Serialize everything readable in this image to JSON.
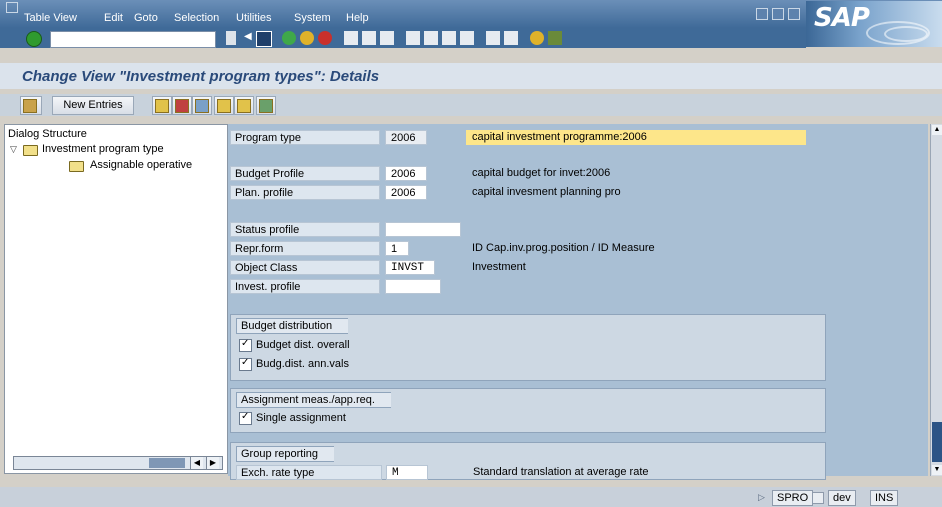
{
  "menu": {
    "items": [
      {
        "label": "Table View"
      },
      {
        "label": "Edit"
      },
      {
        "label": "Goto"
      },
      {
        "label": "Selection"
      },
      {
        "label": "Utilities"
      },
      {
        "label": "System"
      },
      {
        "label": "Help"
      }
    ]
  },
  "brand": {
    "logo_text": "SAP"
  },
  "toolbar": {
    "command_field_value": ""
  },
  "title": {
    "text": "Change View \"Investment program types\": Details"
  },
  "app_toolbar": {
    "new_entries_label": "New Entries"
  },
  "tree": {
    "header": "Dialog Structure",
    "items": [
      {
        "label": "Investment program type"
      },
      {
        "label": "Assignable operative"
      }
    ]
  },
  "form": {
    "program_type": {
      "label": "Program type",
      "value": "2006",
      "desc": "capital investment programme:2006"
    },
    "budget_profile": {
      "label": "Budget Profile",
      "value": "2006",
      "desc": "capital budget for invet:2006"
    },
    "plan_profile": {
      "label": "Plan. profile",
      "value": "2006",
      "desc": "capital invesment planning pro"
    },
    "status_profile": {
      "label": "Status profile",
      "value": ""
    },
    "repr_form": {
      "label": "Repr.form",
      "value": "1",
      "desc": "ID  Cap.inv.prog.position / ID  Measure"
    },
    "object_class": {
      "label": "Object Class",
      "value": "INVST",
      "desc": "Investment"
    },
    "invest_profile": {
      "label": "Invest. profile",
      "value": ""
    }
  },
  "groups": {
    "budget_distribution": {
      "title": "Budget distribution",
      "budget_dist_overall": "Budget dist. overall",
      "budg_dist_ann_vals": "Budg.dist. ann.vals"
    },
    "assignment": {
      "title": "Assignment meas./app.req.",
      "single_assignment": "Single assignment"
    },
    "group_reporting": {
      "title": "Group reporting",
      "exch_rate_label": "Exch. rate type",
      "exch_rate_value": "M",
      "exch_rate_desc": "Standard translation at average rate"
    }
  },
  "status": {
    "transaction": "SPRO",
    "system": "dev",
    "mode": "INS"
  },
  "colors": {
    "menubar": "#3f6a98",
    "highlight_desc": "#fde68a",
    "main_bg": "#a9bfd4"
  }
}
